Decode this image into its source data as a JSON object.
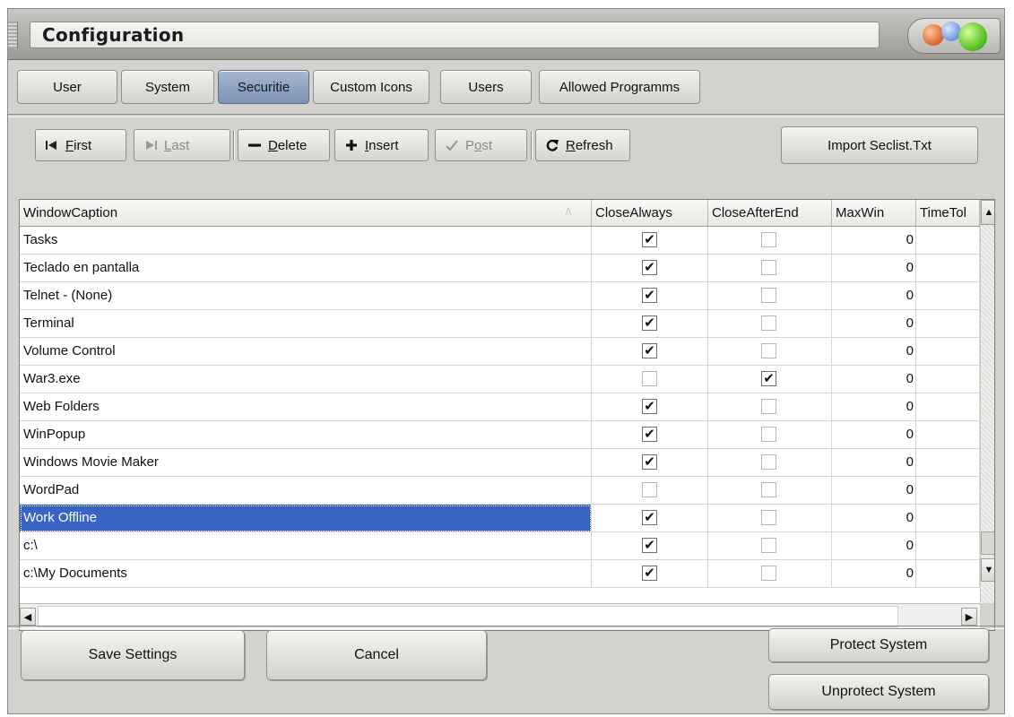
{
  "window": {
    "title": "Configuration"
  },
  "tabs": [
    {
      "label": "User"
    },
    {
      "label": "System"
    },
    {
      "label": "Securitie",
      "active": true
    },
    {
      "label": "Custom Icons"
    },
    {
      "label": "Users"
    },
    {
      "label": "Allowed Programms"
    }
  ],
  "toolbar": {
    "first": {
      "pre": "",
      "key": "F",
      "post": "irst",
      "icon": "first-icon",
      "enabled": true
    },
    "last": {
      "pre": "",
      "key": "L",
      "post": "ast",
      "icon": "last-icon",
      "enabled": false
    },
    "delete": {
      "pre": "",
      "key": "D",
      "post": "elete",
      "icon": "minus-icon",
      "enabled": true
    },
    "insert": {
      "pre": "",
      "key": "I",
      "post": "nsert",
      "icon": "plus-icon",
      "enabled": true
    },
    "post": {
      "pre": "P",
      "key": "o",
      "post": "st",
      "icon": "checkmark-icon",
      "enabled": false
    },
    "refresh": {
      "pre": "",
      "key": "R",
      "post": "efresh",
      "icon": "refresh-icon",
      "enabled": true
    },
    "import_label": "Import Seclist.Txt"
  },
  "grid": {
    "columns": [
      "WindowCaption",
      "CloseAlways",
      "CloseAfterEnd",
      "MaxWin",
      "TimeTol"
    ],
    "sort_indicator": "/\\",
    "selected_row": 10,
    "rows": [
      {
        "caption": "Tasks",
        "close_always": true,
        "close_after_end": false,
        "maxwin": "0"
      },
      {
        "caption": "Teclado en pantalla",
        "close_always": true,
        "close_after_end": false,
        "maxwin": "0"
      },
      {
        "caption": "Telnet - (None)",
        "close_always": true,
        "close_after_end": false,
        "maxwin": "0"
      },
      {
        "caption": "Terminal",
        "close_always": true,
        "close_after_end": false,
        "maxwin": "0"
      },
      {
        "caption": "Volume Control",
        "close_always": true,
        "close_after_end": false,
        "maxwin": "0"
      },
      {
        "caption": "War3.exe",
        "close_always": false,
        "close_after_end": true,
        "maxwin": "0"
      },
      {
        "caption": "Web Folders",
        "close_always": true,
        "close_after_end": false,
        "maxwin": "0"
      },
      {
        "caption": "WinPopup",
        "close_always": true,
        "close_after_end": false,
        "maxwin": "0"
      },
      {
        "caption": "Windows Movie Maker",
        "close_always": true,
        "close_after_end": false,
        "maxwin": "0"
      },
      {
        "caption": "WordPad",
        "close_always": false,
        "close_after_end": false,
        "maxwin": "0"
      },
      {
        "caption": "Work Offline",
        "close_always": true,
        "close_after_end": false,
        "maxwin": "0"
      },
      {
        "caption": "c:\\",
        "close_always": true,
        "close_after_end": false,
        "maxwin": "0"
      },
      {
        "caption": "c:\\My Documents",
        "close_always": true,
        "close_after_end": false,
        "maxwin": "0"
      }
    ],
    "check_glyph": "✔"
  },
  "buttons": {
    "save": "Save Settings",
    "cancel": "Cancel",
    "protect": "Protect System",
    "unprotect": "Unprotect System"
  },
  "colors": {
    "selection": "#3865c4",
    "active_tab": "#7d92b3",
    "background": "#d4d2ce"
  }
}
